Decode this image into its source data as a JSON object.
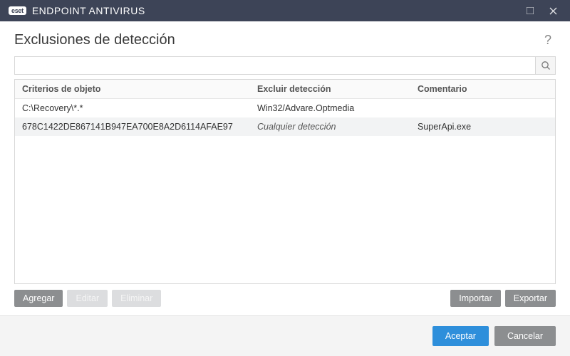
{
  "titlebar": {
    "brand_badge": "eset",
    "product_name": "ENDPOINT ANTIVIRUS"
  },
  "header": {
    "title": "Exclusiones de detección",
    "help_symbol": "?"
  },
  "search": {
    "placeholder": "",
    "value": ""
  },
  "table": {
    "columns": {
      "criteria": "Criterios de objeto",
      "exclude": "Excluir detección",
      "comment": "Comentario"
    },
    "rows": [
      {
        "criteria": "C:\\Recovery\\*.*",
        "exclude": "Win32/Advare.Optmedia",
        "exclude_italic": false,
        "comment": ""
      },
      {
        "criteria": "678C1422DE867141B947EA700E8A2D6114AFAE97",
        "exclude": "Cualquier detección",
        "exclude_italic": true,
        "comment": "SuperApi.exe"
      }
    ]
  },
  "toolbar": {
    "add": "Agregar",
    "edit": "Editar",
    "delete": "Eliminar",
    "import": "Importar",
    "export": "Exportar"
  },
  "footer": {
    "accept": "Aceptar",
    "cancel": "Cancelar"
  }
}
